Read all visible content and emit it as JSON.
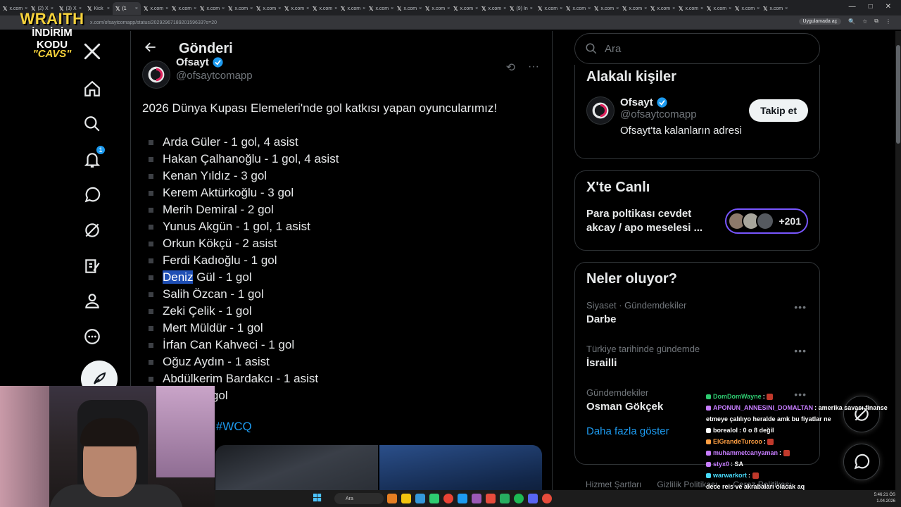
{
  "browser": {
    "tabs": [
      {
        "label": "x.com"
      },
      {
        "label": "(2) X"
      },
      {
        "label": "(3) X"
      },
      {
        "label": "Kick"
      },
      {
        "label": "(1"
      },
      {
        "label": "x.com"
      },
      {
        "label": "x.com"
      },
      {
        "label": "x.com"
      },
      {
        "label": "x.com"
      },
      {
        "label": "x.com"
      },
      {
        "label": "x.com"
      },
      {
        "label": "x.com"
      },
      {
        "label": "x.com"
      },
      {
        "label": "x.com"
      },
      {
        "label": "x.com"
      },
      {
        "label": "x.com"
      },
      {
        "label": "x.com"
      },
      {
        "label": "x.com"
      },
      {
        "label": "(9) In"
      },
      {
        "label": "x.com"
      },
      {
        "label": "x.com"
      },
      {
        "label": "x.com"
      },
      {
        "label": "x.com"
      },
      {
        "label": "x.com"
      },
      {
        "label": "x.com"
      },
      {
        "label": "x.com"
      },
      {
        "label": "x.com"
      },
      {
        "label": "x.com"
      }
    ],
    "url": "x.com/ofsaytcomapp/status/2029296718920159633?s=20",
    "open_in_app": "Uygulamada aç"
  },
  "overlay": {
    "brand": "WRAITH",
    "promo_line": "İNDİRİM KODU",
    "promo_code": "\"CAVS\""
  },
  "nav": {
    "notifications_badge": "1"
  },
  "main": {
    "header_title": "Gönderi",
    "author_name": "Ofsayt",
    "author_handle": "@ofsaytcomapp",
    "tweet_intro": "2026 Dünya Kupası Elemeleri'nde gol katkısı yapan oyuncularımız!",
    "players": [
      "Arda Güler - 1 gol, 4 asist",
      "Hakan Çalhanoğlu - 1 gol, 4 asist",
      "Kenan Yıldız - 3 gol",
      "Kerem Aktürkoğlu - 3 gol",
      "Merih Demiral - 2 gol",
      "Yunus Akgün - 1 gol, 1 asist",
      "Orkun Kökçü - 2 asist",
      "Ferdi Kadıoğlu - 1 gol",
      "Deniz Gül - 1 gol",
      "Salih Özcan - 1 gol",
      "Zeki Çelik - 1 gol",
      "Mert Müldür - 1 gol",
      "İrfan Can Kahveci - 1 gol",
      "Oğuz Aydın - 1 asist",
      "Abdülkerim Bardakcı - 1 asist",
      "esine - 2 gol"
    ],
    "highlight_word": "Deniz",
    "hashtags_visible": "lar | #WCQ"
  },
  "right": {
    "search_placeholder": "Ara",
    "relevant_people": {
      "title": "Alakalı kişiler",
      "name": "Ofsayt",
      "handle": "@ofsaytcomapp",
      "bio": "Ofsayt'ta kalanların adresi",
      "follow_label": "Takip et"
    },
    "live": {
      "title": "X'te Canlı",
      "line1": "Para poltikası cevdet",
      "line2": "akcay / apo meselesi ...",
      "count": "+201"
    },
    "trends": {
      "title": "Neler oluyor?",
      "items": [
        {
          "category": "Siyaset · Gündemdekiler",
          "name": "Darbe"
        },
        {
          "category": "Türkiye tarihinde gündemde",
          "name": "İsrailli"
        },
        {
          "category": "Gündemdekiler",
          "name": "Osman Gökçek"
        }
      ],
      "show_more": "Daha fazla göster"
    },
    "footer": [
      "Hizmet Şartları",
      "Gizlilik Politikası",
      "Çerez Politikası"
    ]
  },
  "chat": [
    {
      "user": "DomDomWayne",
      "color": "#2ecc71",
      "msg": ""
    },
    {
      "user": "APONUN_ANNESINI_DOMALTAN",
      "color": "#c77dff",
      "msg": "amerika savası finanse etmeye çalılıyo heralde amk bu fiyatlar ne"
    },
    {
      "user": "borealol",
      "color": "#ffffff",
      "msg": "0 o 8 değil"
    },
    {
      "user": "ElGrandeTurcoo",
      "color": "#ff9f43",
      "msg": ""
    },
    {
      "user": "muhammetcanyaman",
      "color": "#c77dff",
      "msg": ""
    },
    {
      "user": "styx0",
      "color": "#c77dff",
      "msg": "SA"
    },
    {
      "user": "warwarkort",
      "color": "#48dbfb",
      "msg": ""
    },
    {
      "user": "",
      "color": "#ffffff",
      "msg": "dece reis ve akrabaları olacak aq"
    }
  ],
  "taskbar": {
    "search": "Ara",
    "time": "5:46:21 ÖS",
    "date": "1.04.2026"
  }
}
